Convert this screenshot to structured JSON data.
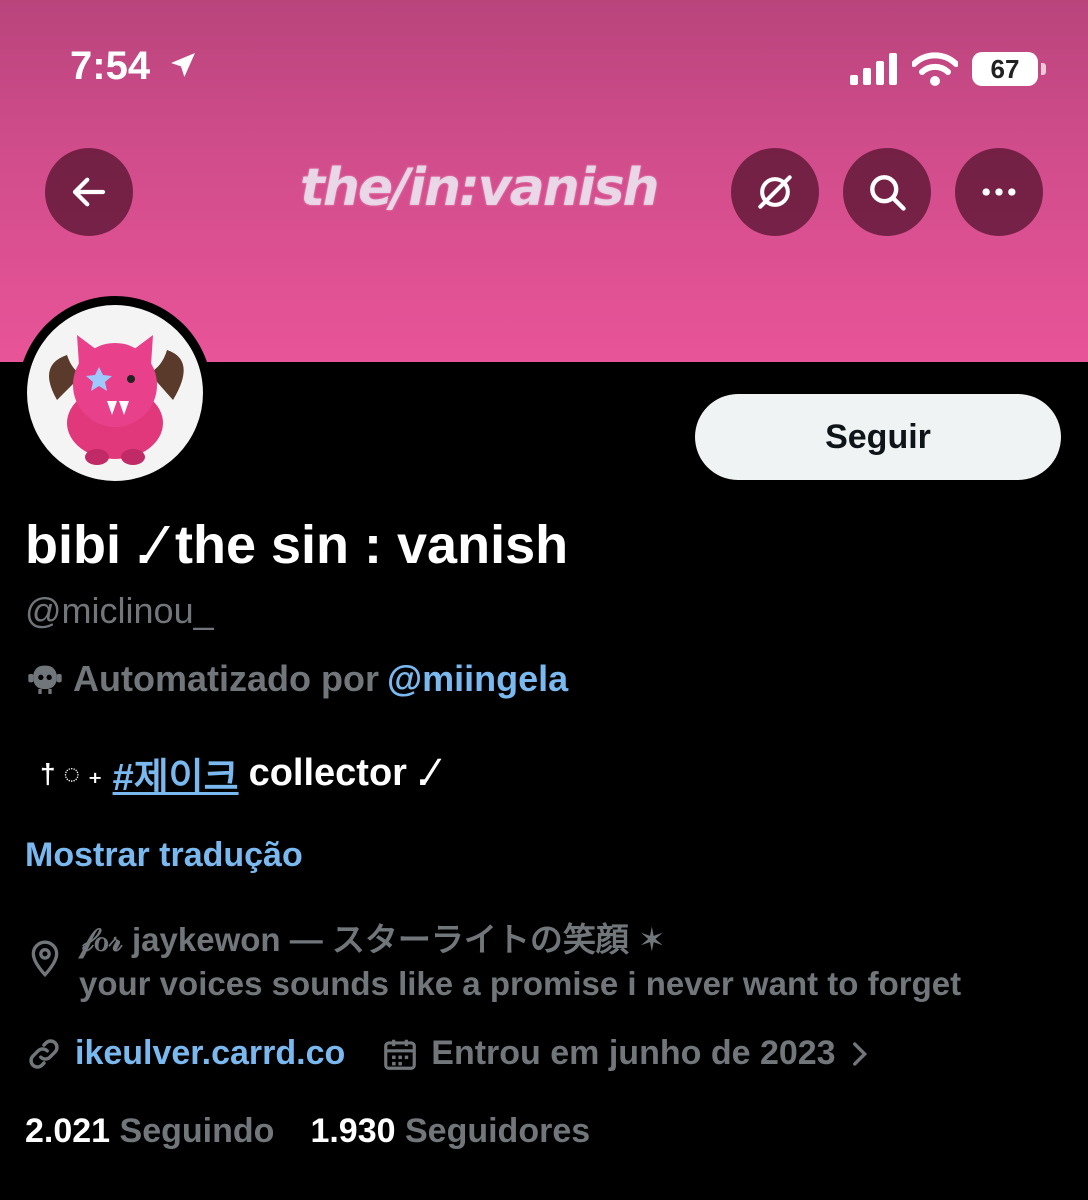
{
  "status_bar": {
    "time": "7:54",
    "battery": "67"
  },
  "banner": {
    "logo_text": "the/in:vanish"
  },
  "profile": {
    "follow_label": "Seguir",
    "display_name": "bibi .⁄ the sin : vanish",
    "handle": "@miclinou_",
    "automated_text": "Automatizado por",
    "automated_by": "@miingela",
    "bio_prefix": "† ◌ ₊",
    "bio_hashtag": "#제이크",
    "bio_suffix": "collector .⁄",
    "translate_label": "Mostrar tradução",
    "location_line1": "𝒻ℴ𝓇 jaykewon — スターライトの笑顔 ✶",
    "location_line2": "your voices sounds like a promise i never want to forget",
    "website": "ikeulver.carrd.co",
    "joined": "Entrou em junho de 2023",
    "following_count": "2.021",
    "following_label": "Seguindo",
    "followers_count": "1.930",
    "followers_label": "Seguidores"
  }
}
